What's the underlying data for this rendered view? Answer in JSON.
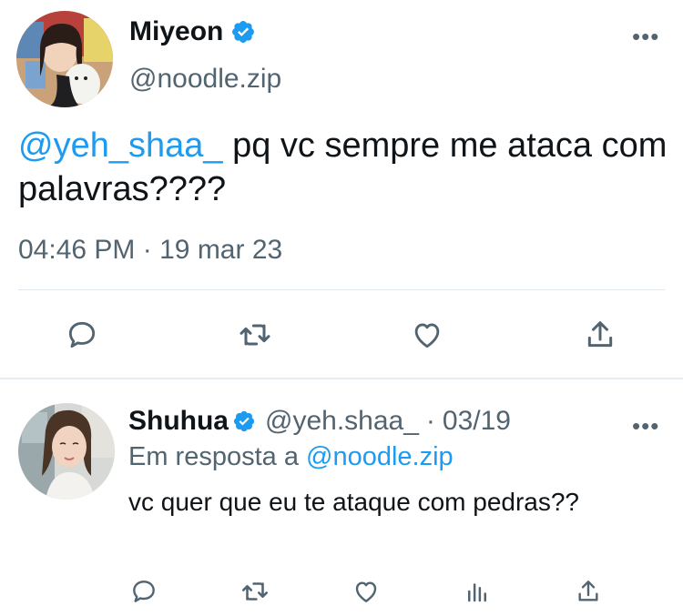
{
  "main_tweet": {
    "display_name": "Miyeon",
    "handle": "@noodle.zip",
    "mention": "@yeh_shaa_",
    "text": " pq vc sempre me ataca com palavras????",
    "time": "04:46 PM",
    "date_separator": "·",
    "date": "19 mar 23",
    "more_label": "•••",
    "actions": [
      "reply-icon",
      "retweet-icon",
      "like-icon",
      "share-icon"
    ]
  },
  "reply_tweet": {
    "display_name": "Shuhua",
    "handle": "@yeh.shaa_",
    "date_separator": "·",
    "date": "03/19",
    "replying_to_label": "Em resposta a ",
    "replying_to_handle": "@noodle.zip",
    "text": "vc quer que eu te ataque com pedras??",
    "more_label": "•••",
    "actions": [
      "reply-icon",
      "retweet-icon",
      "like-icon",
      "analytics-icon",
      "share-icon"
    ]
  },
  "colors": {
    "accent": "#1d9bf0",
    "text": "#0f1419",
    "secondary": "#536471",
    "icon": "#536471",
    "divider": "#e1e8ed"
  }
}
